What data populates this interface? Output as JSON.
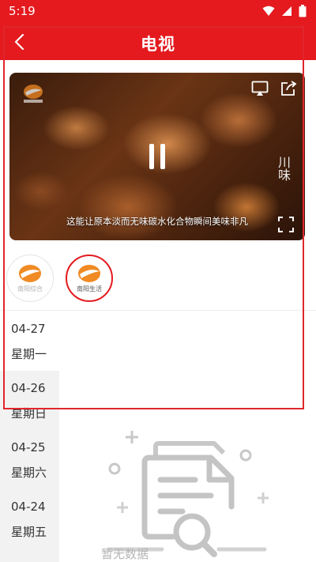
{
  "status_bar": {
    "time": "5:19",
    "icons": [
      "wifi-icon",
      "signal-icon",
      "battery-icon"
    ]
  },
  "header": {
    "title": "电视",
    "back_icon": "back-arrow-icon",
    "background_color": "#e41a1f"
  },
  "video": {
    "subtitle": "这能让原本淡而无味碳水化合物瞬间美味非凡",
    "watermark": "川味",
    "controls": [
      "cast-icon",
      "share-icon",
      "pause-icon",
      "fullscreen-icon"
    ]
  },
  "channels": [
    {
      "name": "南阳综合",
      "active": false
    },
    {
      "name": "南阳生活",
      "active": true
    }
  ],
  "dates": [
    {
      "day": "04-27",
      "week": "星期一",
      "active": true
    },
    {
      "day": "04-26",
      "week": "星期日",
      "active": false
    },
    {
      "day": "04-25",
      "week": "星期六",
      "active": false
    },
    {
      "day": "04-24",
      "week": "星期五",
      "active": false
    }
  ],
  "empty_state": {
    "text": "暂无数据",
    "icon": "empty-document-icon"
  },
  "colors": {
    "accent": "#e41a1f",
    "logo_orange": "#f08a24",
    "date_bg": "#f2f2f2"
  }
}
